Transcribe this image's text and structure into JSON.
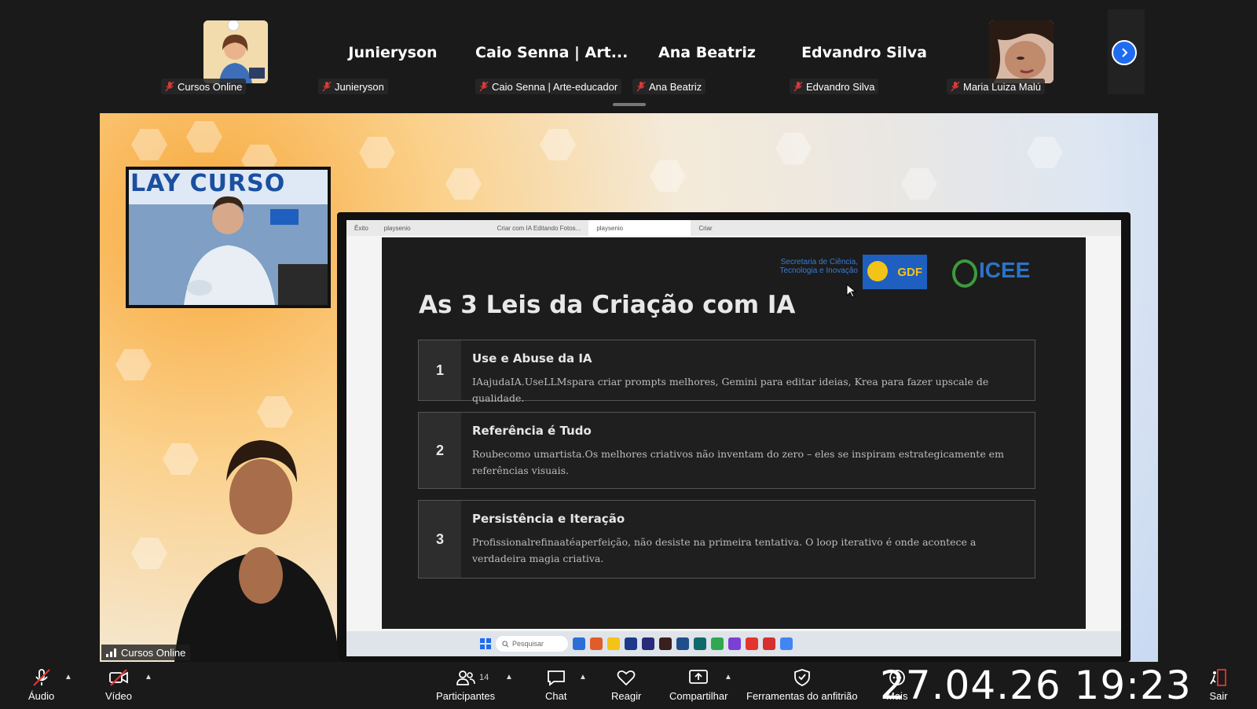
{
  "participants": [
    {
      "label": "Cursos Online",
      "big_name": "",
      "avatar": "illustration-avatar"
    },
    {
      "label": "Junieryson",
      "big_name": "Junieryson"
    },
    {
      "label": "Caio Senna | Arte-educador",
      "big_name": "Caio Senna | Art..."
    },
    {
      "label": "Ana Beatriz",
      "big_name": "Ana Beatriz"
    },
    {
      "label": "Edvandro Silva",
      "big_name": "Edvandro Silva"
    },
    {
      "label": "Maria Luiza Malú",
      "big_name": "",
      "avatar": "photo-avatar"
    }
  ],
  "presenter_banner": "LAY CURSO",
  "browser": {
    "tabs": [
      "Êxito",
      "playsenio",
      "Criar com IA Editando Fotos...",
      "playsenio"
    ],
    "new_tab": "Criar"
  },
  "slide": {
    "title": "As 3 Leis da Criação com IA",
    "secretaria": "Secretaria de Ciência, Tecnologia e Inovação",
    "gdf_logo": "GDF",
    "icee_logo": "ICEE",
    "laws": [
      {
        "num": "1",
        "title": "Use e Abuse da IA",
        "desc": "IAajudaIA.UseLLMspara criar prompts melhores, Gemini para editar ideias, Krea para fazer upscale de qualidade."
      },
      {
        "num": "2",
        "title": "Referência é Tudo",
        "desc": "Roubecomo umartista.Os melhores criativos não inventam do zero – eles se inspiram estrategicamente em referências visuais."
      },
      {
        "num": "3",
        "title": "Persistência e Iteração",
        "desc": "Profissionalrefinaatéaperfeição, não desiste na primeira tentativa. O loop iterativo é onde acontece a verdadeira magia criativa."
      }
    ]
  },
  "taskbar": {
    "search_placeholder": "Pesquisar"
  },
  "share_label": "Cursos Online",
  "toolbar": {
    "audio": "Áudio",
    "video": "Vídeo",
    "participants": "Participantes",
    "participants_count": "14",
    "chat": "Chat",
    "react": "Reagir",
    "share": "Compartilhar",
    "host_tools": "Ferramentas do anfitrião",
    "more": "Mais",
    "leave": "Sair",
    "clock": "27.04.26 19:23"
  },
  "colors": {
    "accent": "#1f6cf0",
    "muted_red": "#d93b3b",
    "slide_bg": "#1c1c1c"
  }
}
